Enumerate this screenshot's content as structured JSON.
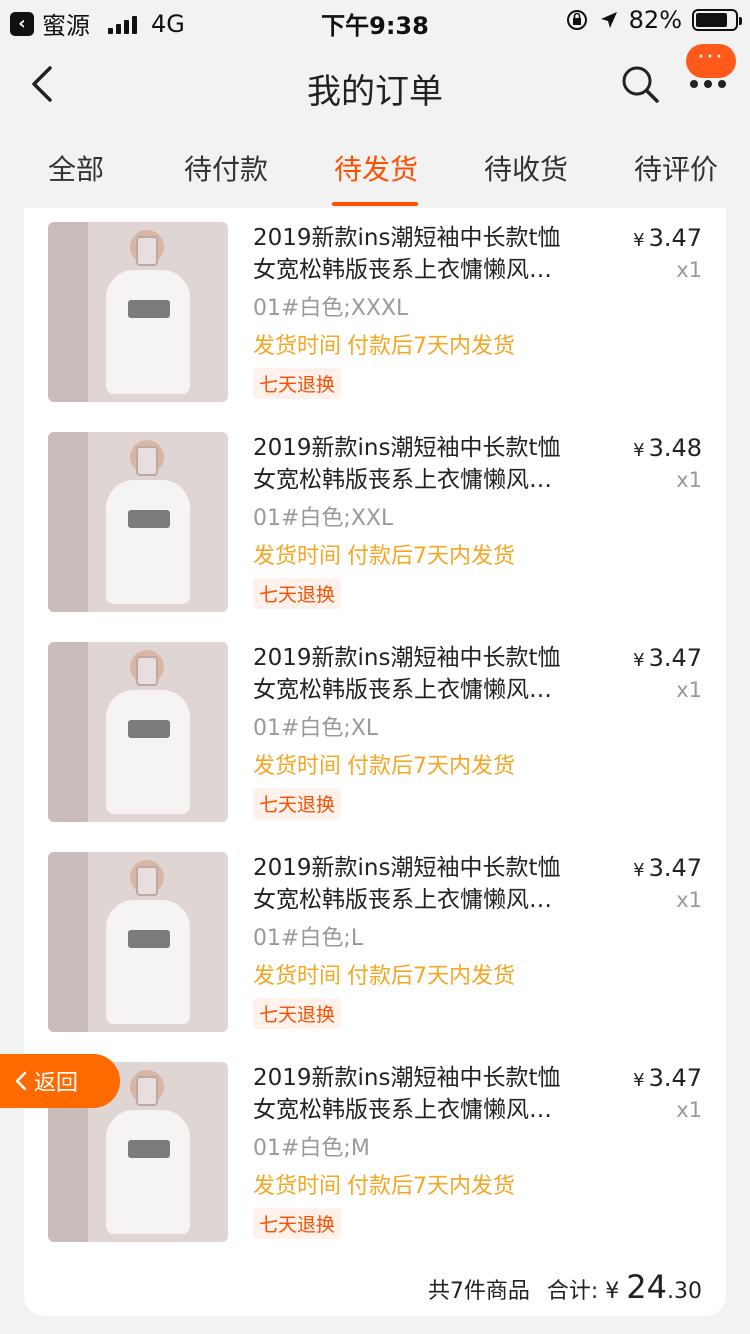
{
  "status_bar": {
    "carrier": "蜜源",
    "network": "4G",
    "time": "下午9:38",
    "battery": "82%"
  },
  "nav": {
    "title": "我的订单",
    "badge": "···"
  },
  "tabs": [
    {
      "label": "全部"
    },
    {
      "label": "待付款"
    },
    {
      "label": "待发货"
    },
    {
      "label": "待收货"
    },
    {
      "label": "待评价"
    }
  ],
  "colors": {
    "accent": "#ff5000",
    "ship": "#f5a623"
  },
  "items": [
    {
      "title_line1": "2019新款ins潮短袖中长款t恤",
      "title_line2": "女宽松韩版丧系上衣慵懒风…",
      "sku": "01#白色;XXXL",
      "ship_label": "发货时间",
      "ship_text": "付款后7天内发货",
      "badge": "七天退换",
      "currency": "¥",
      "price": "3.47",
      "qty": "x1"
    },
    {
      "title_line1": "2019新款ins潮短袖中长款t恤",
      "title_line2": "女宽松韩版丧系上衣慵懒风…",
      "sku": "01#白色;XXL",
      "ship_label": "发货时间",
      "ship_text": "付款后7天内发货",
      "badge": "七天退换",
      "currency": "¥",
      "price": "3.48",
      "qty": "x1"
    },
    {
      "title_line1": "2019新款ins潮短袖中长款t恤",
      "title_line2": "女宽松韩版丧系上衣慵懒风…",
      "sku": "01#白色;XL",
      "ship_label": "发货时间",
      "ship_text": "付款后7天内发货",
      "badge": "七天退换",
      "currency": "¥",
      "price": "3.47",
      "qty": "x1"
    },
    {
      "title_line1": "2019新款ins潮短袖中长款t恤",
      "title_line2": "女宽松韩版丧系上衣慵懒风…",
      "sku": "01#白色;L",
      "ship_label": "发货时间",
      "ship_text": "付款后7天内发货",
      "badge": "七天退换",
      "currency": "¥",
      "price": "3.47",
      "qty": "x1"
    },
    {
      "title_line1": "2019新款ins潮短袖中长款t恤",
      "title_line2": "女宽松韩版丧系上衣慵懒风…",
      "sku": "01#白色;M",
      "ship_label": "发货时间",
      "ship_text": "付款后7天内发货",
      "badge": "七天退换",
      "currency": "¥",
      "price": "3.47",
      "qty": "x1"
    }
  ],
  "summary": {
    "count_text": "共7件商品",
    "total_label": "合计:",
    "currency": "¥",
    "total_int": "24",
    "total_dec": ".30"
  },
  "float_back": {
    "label": "返回"
  }
}
